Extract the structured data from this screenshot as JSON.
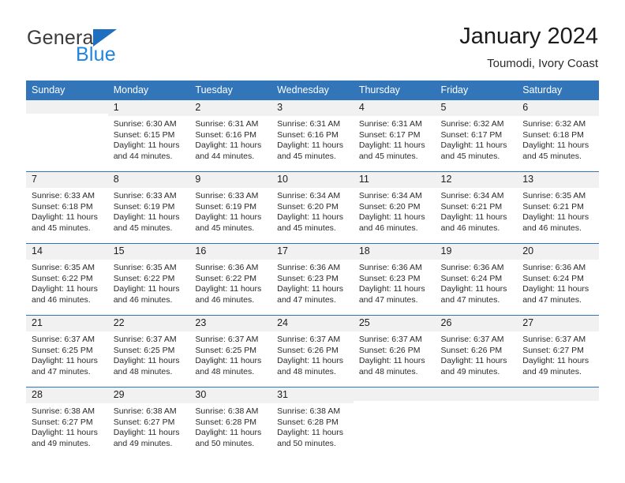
{
  "brand": {
    "line1": "General",
    "line2": "Blue",
    "flag_color": "#1f6fc0",
    "text_color": "#1f85de"
  },
  "header": {
    "title": "January 2024",
    "location": "Toumodi, Ivory Coast",
    "accent_color": "#3275b9",
    "daynum_band_color": "#f1f1f1"
  },
  "weekdays": [
    "Sunday",
    "Monday",
    "Tuesday",
    "Wednesday",
    "Thursday",
    "Friday",
    "Saturday"
  ],
  "weeks": [
    [
      {
        "day": "",
        "sunrise": "",
        "sunset": "",
        "daylight_line1": "",
        "daylight_line2": ""
      },
      {
        "day": "1",
        "sunrise": "Sunrise: 6:30 AM",
        "sunset": "Sunset: 6:15 PM",
        "daylight_line1": "Daylight: 11 hours",
        "daylight_line2": "and 44 minutes."
      },
      {
        "day": "2",
        "sunrise": "Sunrise: 6:31 AM",
        "sunset": "Sunset: 6:16 PM",
        "daylight_line1": "Daylight: 11 hours",
        "daylight_line2": "and 44 minutes."
      },
      {
        "day": "3",
        "sunrise": "Sunrise: 6:31 AM",
        "sunset": "Sunset: 6:16 PM",
        "daylight_line1": "Daylight: 11 hours",
        "daylight_line2": "and 45 minutes."
      },
      {
        "day": "4",
        "sunrise": "Sunrise: 6:31 AM",
        "sunset": "Sunset: 6:17 PM",
        "daylight_line1": "Daylight: 11 hours",
        "daylight_line2": "and 45 minutes."
      },
      {
        "day": "5",
        "sunrise": "Sunrise: 6:32 AM",
        "sunset": "Sunset: 6:17 PM",
        "daylight_line1": "Daylight: 11 hours",
        "daylight_line2": "and 45 minutes."
      },
      {
        "day": "6",
        "sunrise": "Sunrise: 6:32 AM",
        "sunset": "Sunset: 6:18 PM",
        "daylight_line1": "Daylight: 11 hours",
        "daylight_line2": "and 45 minutes."
      }
    ],
    [
      {
        "day": "7",
        "sunrise": "Sunrise: 6:33 AM",
        "sunset": "Sunset: 6:18 PM",
        "daylight_line1": "Daylight: 11 hours",
        "daylight_line2": "and 45 minutes."
      },
      {
        "day": "8",
        "sunrise": "Sunrise: 6:33 AM",
        "sunset": "Sunset: 6:19 PM",
        "daylight_line1": "Daylight: 11 hours",
        "daylight_line2": "and 45 minutes."
      },
      {
        "day": "9",
        "sunrise": "Sunrise: 6:33 AM",
        "sunset": "Sunset: 6:19 PM",
        "daylight_line1": "Daylight: 11 hours",
        "daylight_line2": "and 45 minutes."
      },
      {
        "day": "10",
        "sunrise": "Sunrise: 6:34 AM",
        "sunset": "Sunset: 6:20 PM",
        "daylight_line1": "Daylight: 11 hours",
        "daylight_line2": "and 45 minutes."
      },
      {
        "day": "11",
        "sunrise": "Sunrise: 6:34 AM",
        "sunset": "Sunset: 6:20 PM",
        "daylight_line1": "Daylight: 11 hours",
        "daylight_line2": "and 46 minutes."
      },
      {
        "day": "12",
        "sunrise": "Sunrise: 6:34 AM",
        "sunset": "Sunset: 6:21 PM",
        "daylight_line1": "Daylight: 11 hours",
        "daylight_line2": "and 46 minutes."
      },
      {
        "day": "13",
        "sunrise": "Sunrise: 6:35 AM",
        "sunset": "Sunset: 6:21 PM",
        "daylight_line1": "Daylight: 11 hours",
        "daylight_line2": "and 46 minutes."
      }
    ],
    [
      {
        "day": "14",
        "sunrise": "Sunrise: 6:35 AM",
        "sunset": "Sunset: 6:22 PM",
        "daylight_line1": "Daylight: 11 hours",
        "daylight_line2": "and 46 minutes."
      },
      {
        "day": "15",
        "sunrise": "Sunrise: 6:35 AM",
        "sunset": "Sunset: 6:22 PM",
        "daylight_line1": "Daylight: 11 hours",
        "daylight_line2": "and 46 minutes."
      },
      {
        "day": "16",
        "sunrise": "Sunrise: 6:36 AM",
        "sunset": "Sunset: 6:22 PM",
        "daylight_line1": "Daylight: 11 hours",
        "daylight_line2": "and 46 minutes."
      },
      {
        "day": "17",
        "sunrise": "Sunrise: 6:36 AM",
        "sunset": "Sunset: 6:23 PM",
        "daylight_line1": "Daylight: 11 hours",
        "daylight_line2": "and 47 minutes."
      },
      {
        "day": "18",
        "sunrise": "Sunrise: 6:36 AM",
        "sunset": "Sunset: 6:23 PM",
        "daylight_line1": "Daylight: 11 hours",
        "daylight_line2": "and 47 minutes."
      },
      {
        "day": "19",
        "sunrise": "Sunrise: 6:36 AM",
        "sunset": "Sunset: 6:24 PM",
        "daylight_line1": "Daylight: 11 hours",
        "daylight_line2": "and 47 minutes."
      },
      {
        "day": "20",
        "sunrise": "Sunrise: 6:36 AM",
        "sunset": "Sunset: 6:24 PM",
        "daylight_line1": "Daylight: 11 hours",
        "daylight_line2": "and 47 minutes."
      }
    ],
    [
      {
        "day": "21",
        "sunrise": "Sunrise: 6:37 AM",
        "sunset": "Sunset: 6:25 PM",
        "daylight_line1": "Daylight: 11 hours",
        "daylight_line2": "and 47 minutes."
      },
      {
        "day": "22",
        "sunrise": "Sunrise: 6:37 AM",
        "sunset": "Sunset: 6:25 PM",
        "daylight_line1": "Daylight: 11 hours",
        "daylight_line2": "and 48 minutes."
      },
      {
        "day": "23",
        "sunrise": "Sunrise: 6:37 AM",
        "sunset": "Sunset: 6:25 PM",
        "daylight_line1": "Daylight: 11 hours",
        "daylight_line2": "and 48 minutes."
      },
      {
        "day": "24",
        "sunrise": "Sunrise: 6:37 AM",
        "sunset": "Sunset: 6:26 PM",
        "daylight_line1": "Daylight: 11 hours",
        "daylight_line2": "and 48 minutes."
      },
      {
        "day": "25",
        "sunrise": "Sunrise: 6:37 AM",
        "sunset": "Sunset: 6:26 PM",
        "daylight_line1": "Daylight: 11 hours",
        "daylight_line2": "and 48 minutes."
      },
      {
        "day": "26",
        "sunrise": "Sunrise: 6:37 AM",
        "sunset": "Sunset: 6:26 PM",
        "daylight_line1": "Daylight: 11 hours",
        "daylight_line2": "and 49 minutes."
      },
      {
        "day": "27",
        "sunrise": "Sunrise: 6:37 AM",
        "sunset": "Sunset: 6:27 PM",
        "daylight_line1": "Daylight: 11 hours",
        "daylight_line2": "and 49 minutes."
      }
    ],
    [
      {
        "day": "28",
        "sunrise": "Sunrise: 6:38 AM",
        "sunset": "Sunset: 6:27 PM",
        "daylight_line1": "Daylight: 11 hours",
        "daylight_line2": "and 49 minutes."
      },
      {
        "day": "29",
        "sunrise": "Sunrise: 6:38 AM",
        "sunset": "Sunset: 6:27 PM",
        "daylight_line1": "Daylight: 11 hours",
        "daylight_line2": "and 49 minutes."
      },
      {
        "day": "30",
        "sunrise": "Sunrise: 6:38 AM",
        "sunset": "Sunset: 6:28 PM",
        "daylight_line1": "Daylight: 11 hours",
        "daylight_line2": "and 50 minutes."
      },
      {
        "day": "31",
        "sunrise": "Sunrise: 6:38 AM",
        "sunset": "Sunset: 6:28 PM",
        "daylight_line1": "Daylight: 11 hours",
        "daylight_line2": "and 50 minutes."
      },
      {
        "day": "",
        "sunrise": "",
        "sunset": "",
        "daylight_line1": "",
        "daylight_line2": ""
      },
      {
        "day": "",
        "sunrise": "",
        "sunset": "",
        "daylight_line1": "",
        "daylight_line2": ""
      },
      {
        "day": "",
        "sunrise": "",
        "sunset": "",
        "daylight_line1": "",
        "daylight_line2": ""
      }
    ]
  ]
}
